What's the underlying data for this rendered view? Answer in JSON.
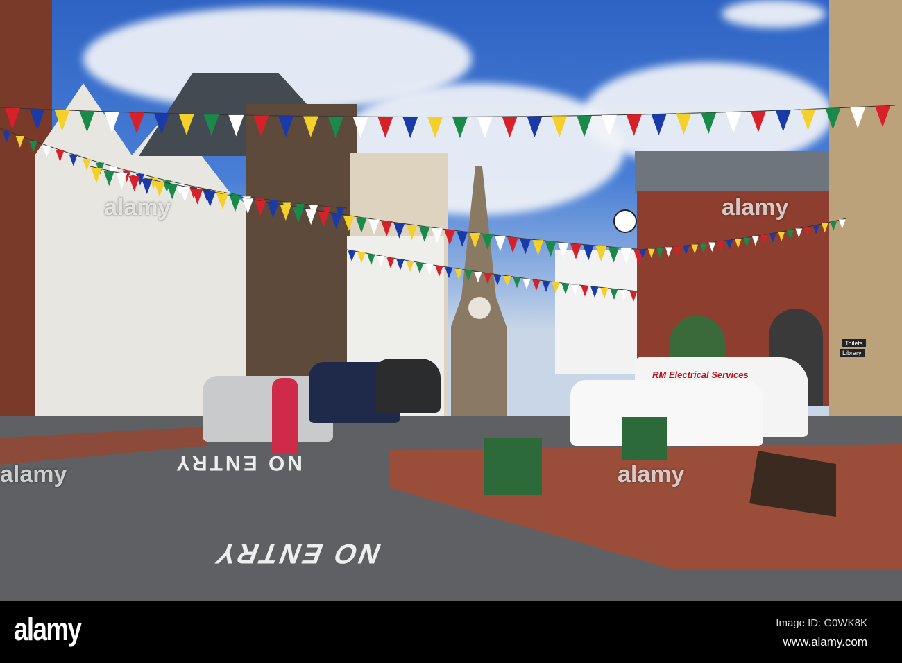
{
  "photo": {
    "road_markings": [
      "NO ENTRY",
      "NO ENTRY"
    ],
    "van_text": "RM Electrical Services",
    "signs": [
      "Toilets",
      "Library"
    ],
    "watermark_text": "alamy",
    "bunting_colors": [
      "#d6202a",
      "#1a3aa8",
      "#f3d02a",
      "#1a8a4a",
      "#ffffff"
    ]
  },
  "footer": {
    "logo": "alamy",
    "image_id": "Image ID: G0WK8K",
    "url": "www.alamy.com"
  }
}
